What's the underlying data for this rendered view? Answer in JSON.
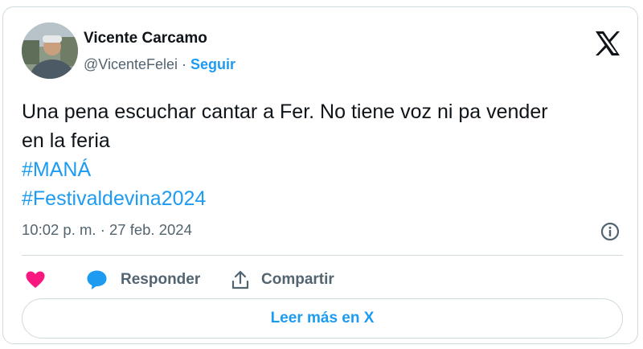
{
  "author": {
    "name": "Vicente Carcamo",
    "handle": "@VicenteFelei",
    "separator": "·",
    "follow_label": "Seguir"
  },
  "tweet": {
    "lines": [
      "Una pena escuchar cantar a Fer. No tiene voz ni pa vender",
      "en la feria"
    ],
    "hashtags": [
      "#MANÁ",
      "#Festivaldevina2024"
    ],
    "timestamp": "10:02 p. m. · 27 feb. 2024"
  },
  "actions": {
    "reply_label": "Responder",
    "share_label": "Compartir"
  },
  "read_more_label": "Leer más en X",
  "icons": {
    "logo": "x-logo-icon",
    "info": "info-icon",
    "like": "heart-icon",
    "reply": "speech-bubble-icon",
    "share": "share-icon"
  },
  "colors": {
    "link": "#1d9bf0",
    "text": "#0f1419",
    "secondary": "#536471",
    "like": "#f91880",
    "border": "#cfd9de"
  }
}
